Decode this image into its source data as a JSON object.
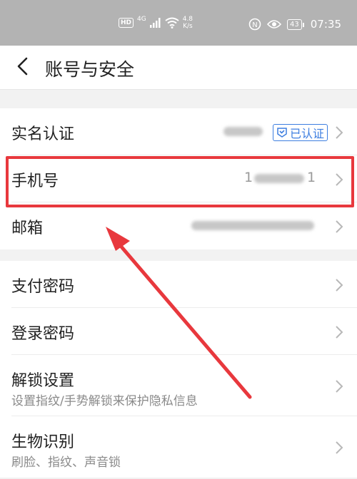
{
  "status_bar": {
    "hd": "HD",
    "network": "4G",
    "speed_value": "4.8",
    "speed_unit": "K/s",
    "battery": "43",
    "time": "07:35",
    "icons": [
      "signal-icon",
      "wifi-icon",
      "nfc-icon",
      "eye-icon",
      "battery-icon"
    ]
  },
  "header": {
    "title": "账号与安全",
    "back_icon": "chevron-left-icon"
  },
  "account_group": {
    "items": [
      {
        "label": "实名认证",
        "value_masked": true,
        "badge": "已认证"
      },
      {
        "label": "手机号",
        "value_prefix": "1",
        "value_suffix": "1",
        "value_masked": true
      },
      {
        "label": "邮箱",
        "value_masked": true
      }
    ]
  },
  "security_group": {
    "items": [
      {
        "label": "支付密码"
      },
      {
        "label": "登录密码"
      },
      {
        "label": "解锁设置",
        "subtitle": "设置指纹/手势解锁来保护隐私信息"
      },
      {
        "label": "生物识别",
        "subtitle": "刷脸、指纹、声音锁"
      }
    ]
  },
  "colors": {
    "accent_blue": "#3d7ee0",
    "annotation_red": "#e8383d",
    "status_bar_bg": "#b3b3b3"
  }
}
